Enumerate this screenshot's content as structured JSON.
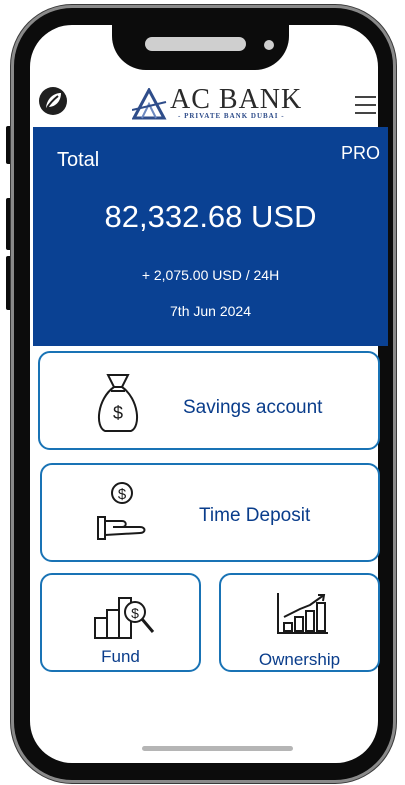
{
  "header": {
    "bank_name": "AC BANK",
    "bank_subtitle": "- PRIVATE BANK DUBAI -"
  },
  "balance": {
    "label": "Total",
    "tier": "PRO",
    "amount": "82,332.68 USD",
    "change": "+ 2,075.00 USD / 24H",
    "date": "7th Jun 2024"
  },
  "actions": {
    "savings": "Savings account",
    "deposit": "Time Deposit",
    "fund": "Fund",
    "ownership": "Ownership"
  },
  "icons": {
    "brand": "leaf-logo-icon",
    "menu": "hamburger-menu-icon",
    "savings": "money-bag-icon",
    "deposit": "hand-coin-icon",
    "fund": "buildings-search-icon",
    "ownership": "growth-chart-icon"
  },
  "colors": {
    "primary": "#0a4193",
    "card_border": "#1973b5",
    "card_text": "#0a3d8b"
  }
}
